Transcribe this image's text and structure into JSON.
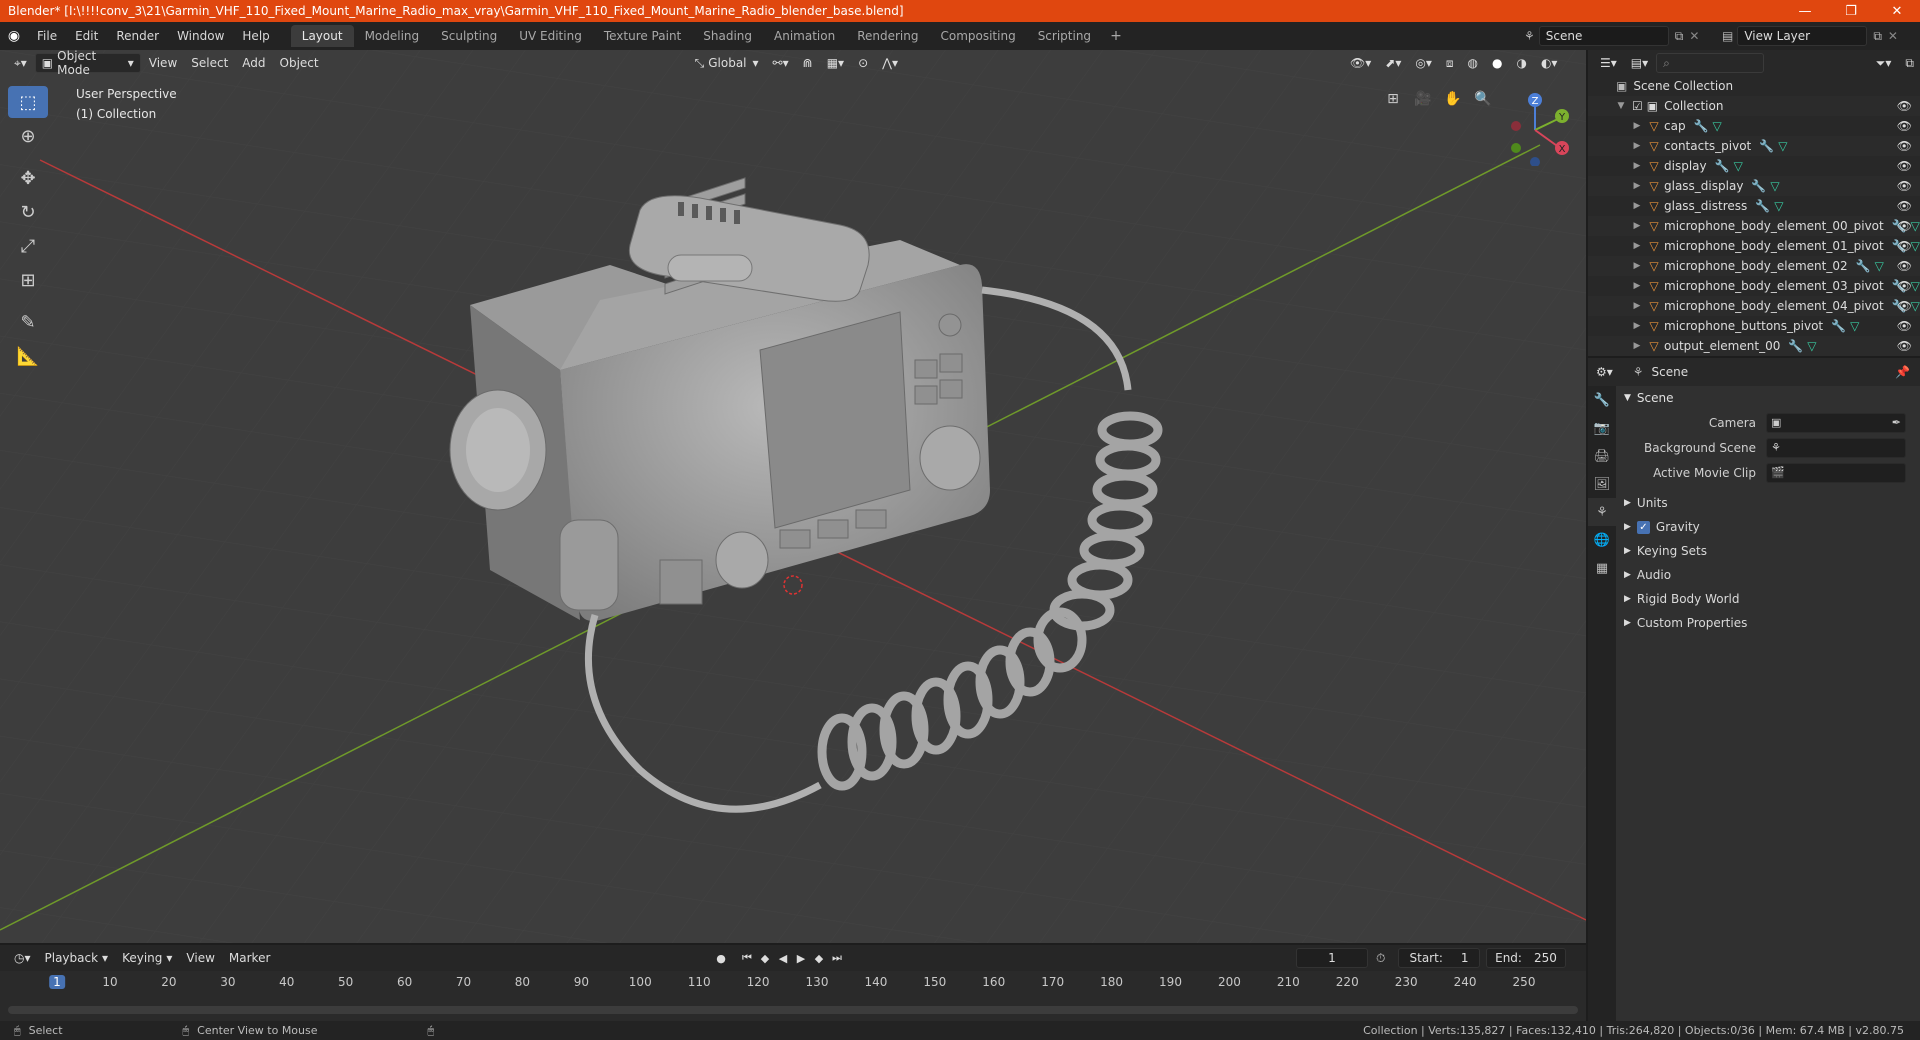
{
  "window": {
    "title": "Blender* [I:\\!!!!conv_3\\21\\Garmin_VHF_110_Fixed_Mount_Marine_Radio_max_vray\\Garmin_VHF_110_Fixed_Mount_Marine_Radio_blender_base.blend]",
    "minimize": "—",
    "maximize": "❐",
    "close": "✕"
  },
  "menu": [
    "File",
    "Edit",
    "Render",
    "Window",
    "Help"
  ],
  "workspaces": [
    "Layout",
    "Modeling",
    "Sculpting",
    "UV Editing",
    "Texture Paint",
    "Shading",
    "Animation",
    "Rendering",
    "Compositing",
    "Scripting"
  ],
  "workspace_add": "+",
  "scene_selector": "Scene",
  "view_layer": "View Layer",
  "viewport": {
    "mode": "Object Mode",
    "menus": [
      "View",
      "Select",
      "Add",
      "Object"
    ],
    "orientation": "Global",
    "perspective_label": "User Perspective",
    "collection_label": "(1) Collection",
    "gizmo": {
      "x": "X",
      "y": "Y",
      "z": "Z"
    }
  },
  "outliner": {
    "root": "Scene Collection",
    "collection": "Collection",
    "items": [
      "cap",
      "contacts_pivot",
      "display",
      "glass_display",
      "glass_distress",
      "microphone_body_element_00_pivot",
      "microphone_body_element_01_pivot",
      "microphone_body_element_02",
      "microphone_body_element_03_pivot",
      "microphone_body_element_04_pivot",
      "microphone_buttons_pivot",
      "output_element_00"
    ]
  },
  "properties": {
    "context": "Scene",
    "panel": "Scene",
    "fields": [
      {
        "label": "Camera",
        "value": ""
      },
      {
        "label": "Background Scene",
        "value": ""
      },
      {
        "label": "Active Movie Clip",
        "value": ""
      }
    ],
    "subpanels": [
      "Units",
      "Gravity",
      "Keying Sets",
      "Audio",
      "Rigid Body World",
      "Custom Properties"
    ],
    "gravity_checked": true
  },
  "timeline": {
    "menus": [
      "Playback",
      "Keying",
      "View",
      "Marker"
    ],
    "current_frame": "1",
    "start_label": "Start:",
    "start": "1",
    "end_label": "End:",
    "end": "250",
    "ruler": [
      "1",
      "10",
      "20",
      "30",
      "40",
      "50",
      "60",
      "70",
      "80",
      "90",
      "100",
      "110",
      "120",
      "130",
      "140",
      "150",
      "160",
      "170",
      "180",
      "190",
      "200",
      "210",
      "220",
      "230",
      "240",
      "250"
    ]
  },
  "status": {
    "select": "Select",
    "center_view": "Center View to Mouse",
    "stats": "Collection | Verts:135,827 | Faces:132,410 | Tris:264,820 | Objects:0/36 | Mem: 67.4 MB | v2.80.75"
  },
  "colors": {
    "title_bar": "#e0470f",
    "accent": "#4772b3",
    "object_icon": "#e8923a",
    "mesh_icon": "#38c9a0",
    "x_axis": "#b83a3a",
    "y_axis": "#6f9a2a"
  }
}
